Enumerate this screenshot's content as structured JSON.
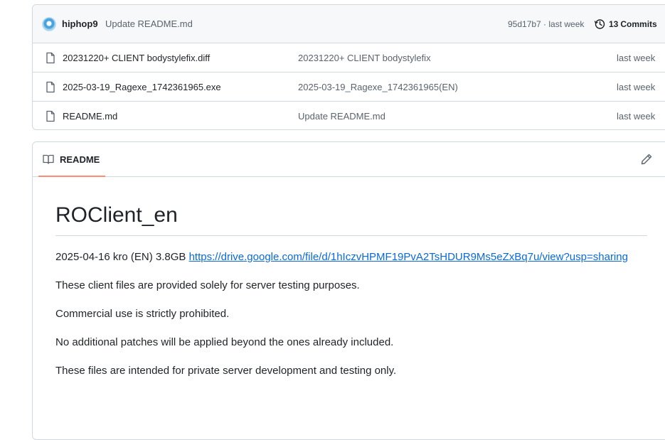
{
  "commit": {
    "author": "hiphop9",
    "message": "Update README.md",
    "hash_age": "95d17b7 · last week",
    "commits_count": "13",
    "commits_label": "Commits"
  },
  "files": [
    {
      "name": "20231220+ CLIENT bodystylefix.diff",
      "commit": "20231220+ CLIENT bodystylefix",
      "age": "last week"
    },
    {
      "name": "2025-03-19_Ragexe_1742361965.exe",
      "commit": "2025-03-19_Ragexe_1742361965(EN)",
      "age": "last week"
    },
    {
      "name": "README.md",
      "commit": "Update README.md",
      "age": "last week"
    }
  ],
  "readme": {
    "tab_label": "README",
    "title": "ROClient_en",
    "line1_prefix": "2025-04-16 kro (EN) 3.8GB ",
    "line1_link": "https://drive.google.com/file/d/1hIczvHPMF19PvA2TsHDUR9Ms5eZxBq7u/view?usp=sharing",
    "paragraphs": [
      "These client files are provided solely for server testing purposes.",
      "Commercial use is strictly prohibited.",
      "No additional patches will be applied beyond the ones already included.",
      "These files are intended for private server development and testing only."
    ]
  },
  "icons": {
    "file": "file-icon",
    "history": "history-icon",
    "book": "book-icon",
    "edit": "pencil-icon"
  },
  "colors": {
    "link": "#0969da",
    "tab_underline": "#fd8c73",
    "border": "#d1d9e0",
    "header_bg": "#f6f8fa"
  }
}
